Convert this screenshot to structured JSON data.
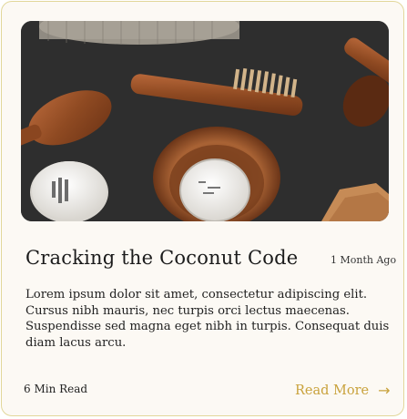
{
  "card": {
    "image_alt": "",
    "title": "Cracking the Coconut Code",
    "time_ago": "1 Month Ago",
    "excerpt": "Lorem ipsum dolor sit amet, consectetur adipiscing elit. Cursus nibh mauris, nec turpis orci lectus maecenas. Suspendisse sed magna eget nibh in turpis. Consequat duis diam lacus arcu.",
    "read_time": "6 Min Read",
    "read_more_label": "Read More",
    "arrow_icon": "arrow-right-icon"
  },
  "colors": {
    "accent": "#c9a23c",
    "card_border": "#e2d79a",
    "card_bg": "#fcf9f4"
  }
}
